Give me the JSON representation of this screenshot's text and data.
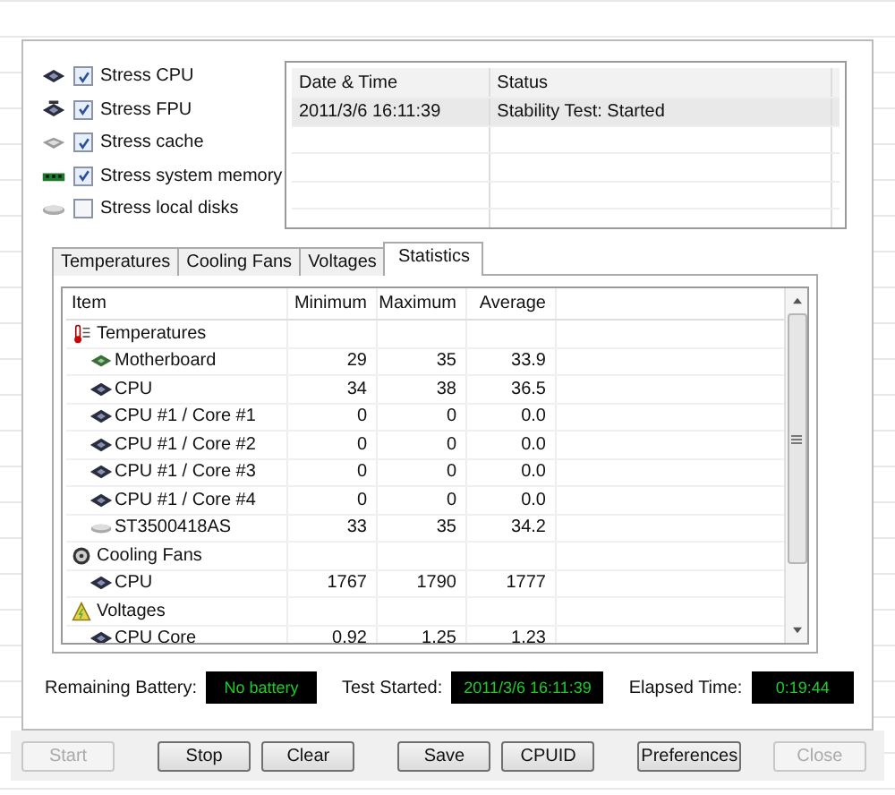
{
  "stress_options": [
    {
      "label": "Stress CPU",
      "checked": true,
      "kind": "cpu"
    },
    {
      "label": "Stress FPU",
      "checked": true,
      "kind": "fpu"
    },
    {
      "label": "Stress cache",
      "checked": true,
      "kind": "cache"
    },
    {
      "label": "Stress system memory",
      "checked": true,
      "kind": "memory"
    },
    {
      "label": "Stress local disks",
      "checked": false,
      "kind": "disk"
    }
  ],
  "log": {
    "columns": [
      "Date & Time",
      "Status"
    ],
    "rows": [
      {
        "cells": [
          "2011/3/6 16:11:39",
          "Stability Test: Started"
        ],
        "selected": true
      }
    ]
  },
  "tabs": [
    {
      "label": "Temperatures",
      "selected": false
    },
    {
      "label": "Cooling Fans",
      "selected": false
    },
    {
      "label": "Voltages",
      "selected": false
    },
    {
      "label": "Statistics",
      "selected": true
    }
  ],
  "statistics": {
    "columns": [
      "Item",
      "Minimum",
      "Maximum",
      "Average"
    ],
    "groups": [
      {
        "label": "Temperatures",
        "kind": "temperature",
        "children": [
          {
            "label": "Motherboard",
            "kind": "board",
            "values": [
              "29",
              "35",
              "33.9"
            ]
          },
          {
            "label": "CPU",
            "kind": "cpu",
            "values": [
              "34",
              "38",
              "36.5"
            ]
          },
          {
            "label": "CPU #1 / Core #1",
            "kind": "cpu",
            "values": [
              "0",
              "0",
              "0.0"
            ]
          },
          {
            "label": "CPU #1 / Core #2",
            "kind": "cpu",
            "values": [
              "0",
              "0",
              "0.0"
            ]
          },
          {
            "label": "CPU #1 / Core #3",
            "kind": "cpu",
            "values": [
              "0",
              "0",
              "0.0"
            ]
          },
          {
            "label": "CPU #1 / Core #4",
            "kind": "cpu",
            "values": [
              "0",
              "0",
              "0.0"
            ]
          },
          {
            "label": "ST3500418AS",
            "kind": "disk",
            "values": [
              "33",
              "35",
              "34.2"
            ]
          }
        ]
      },
      {
        "label": "Cooling Fans",
        "kind": "fan",
        "children": [
          {
            "label": "CPU",
            "kind": "cpu",
            "values": [
              "1767",
              "1790",
              "1777"
            ]
          }
        ]
      },
      {
        "label": "Voltages",
        "kind": "voltage",
        "children": [
          {
            "label": "CPU Core",
            "kind": "cpu",
            "values": [
              "0.92",
              "1.25",
              "1.23"
            ]
          }
        ]
      }
    ]
  },
  "status": [
    {
      "label": "Remaining Battery:",
      "value": "No battery"
    },
    {
      "label": "Test Started:",
      "value": "2011/3/6 16:11:39"
    },
    {
      "label": "Elapsed Time:",
      "value": "0:19:44"
    }
  ],
  "buttons": [
    {
      "label": "Start",
      "disabled": true
    },
    {
      "label": "Stop",
      "disabled": false
    },
    {
      "label": "Clear",
      "disabled": false
    },
    {
      "label": "Save",
      "disabled": false
    },
    {
      "label": "CPUID",
      "disabled": false
    },
    {
      "label": "Preferences",
      "disabled": false
    },
    {
      "label": "Close",
      "disabled": true
    }
  ]
}
